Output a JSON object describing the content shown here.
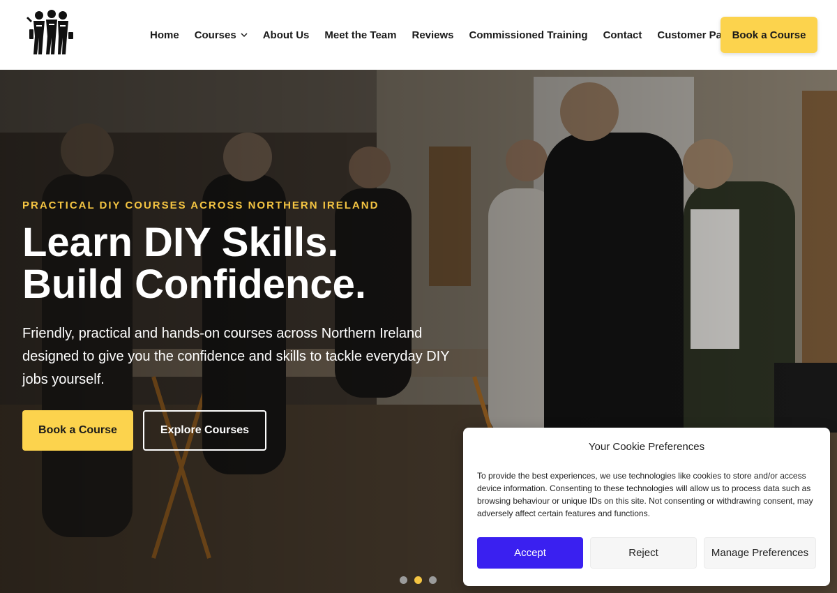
{
  "header": {
    "nav": [
      {
        "label": "Home"
      },
      {
        "label": "Courses"
      },
      {
        "label": "About Us"
      },
      {
        "label": "Meet the Team"
      },
      {
        "label": "Reviews"
      },
      {
        "label": "Commissioned Training"
      },
      {
        "label": "Contact"
      },
      {
        "label": "Customer Panel"
      }
    ],
    "cta_label": "Book a Course"
  },
  "hero": {
    "eyebrow": "PRACTICAL DIY COURSES ACROSS NORTHERN IRELAND",
    "title_line1": "Learn DIY Skills.",
    "title_line2": "Build Confidence.",
    "subtitle": "Friendly, practical and hands-on courses across Northern Ireland designed to give you the confidence and skills to tackle everyday DIY jobs yourself.",
    "primary_button": "Book a Course",
    "secondary_button": "Explore Courses",
    "slides_total": 3,
    "active_slide": 2
  },
  "cookie": {
    "title": "Your Cookie Preferences",
    "text": "To provide the best experiences, we use technologies like cookies to store and/or access device information. Consenting to these technologies will allow us to process data such as browsing behaviour or unique IDs on this site. Not consenting or withdrawing consent, may adversely affect certain features and functions.",
    "accept": "Accept",
    "reject": "Reject",
    "manage": "Manage Preferences"
  },
  "colors": {
    "accent": "#fcd34d",
    "eyebrow": "#f5c542",
    "accept_button": "#3a20f0"
  }
}
